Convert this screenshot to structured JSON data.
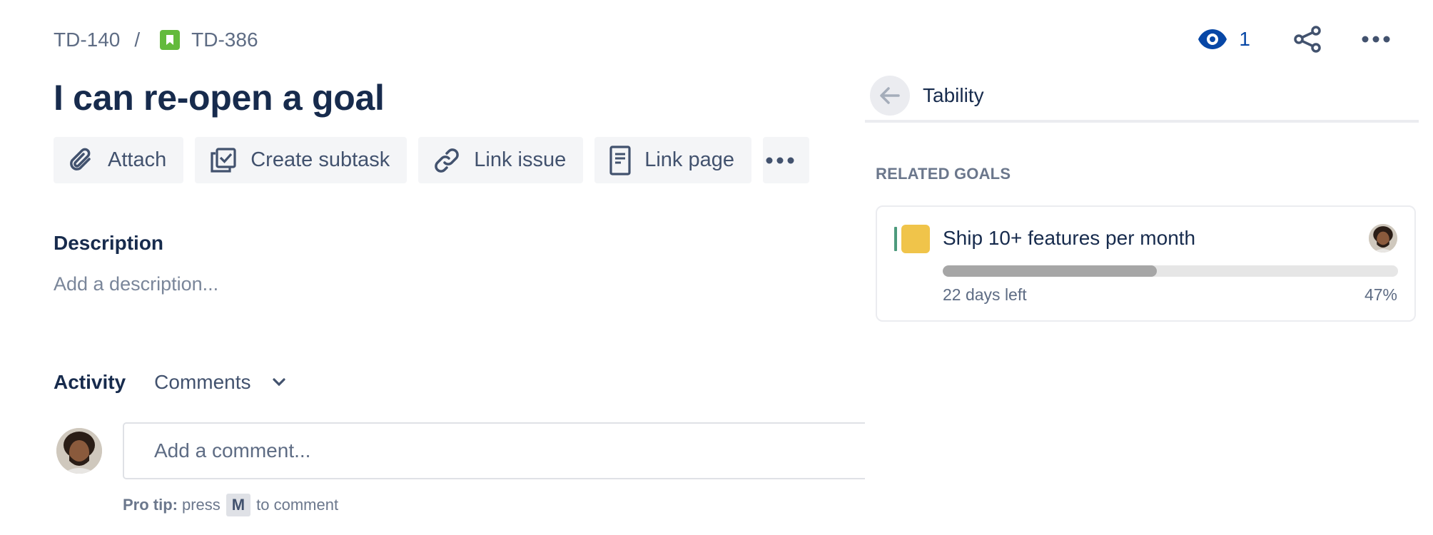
{
  "breadcrumb": {
    "parent": "TD-140",
    "separator": "/",
    "current": "TD-386"
  },
  "header": {
    "watchers_count": "1"
  },
  "issue": {
    "title": "I can re-open a goal"
  },
  "toolbar": {
    "attach": "Attach",
    "create_subtask": "Create subtask",
    "link_issue": "Link issue",
    "link_page": "Link page"
  },
  "description": {
    "heading": "Description",
    "placeholder": "Add a description..."
  },
  "activity": {
    "heading": "Activity",
    "filter": "Comments",
    "comment_placeholder": "Add a comment...",
    "protip_label": "Pro tip:",
    "protip_pre": "press",
    "protip_key": "M",
    "protip_post": "to comment"
  },
  "panel": {
    "title": "Tability",
    "section_heading": "RELATED GOALS",
    "goals": [
      {
        "title": "Ship 10+ features per month",
        "days_left": "22 days left",
        "progress_label": "47%",
        "progress": 0.47
      }
    ]
  },
  "colors": {
    "story_icon": "#63ba3c",
    "watch": "#0747a6",
    "goal_status": "#4c9a7c",
    "goal_square": "#f0c44a",
    "progress_fill": "#a6a6a6"
  }
}
